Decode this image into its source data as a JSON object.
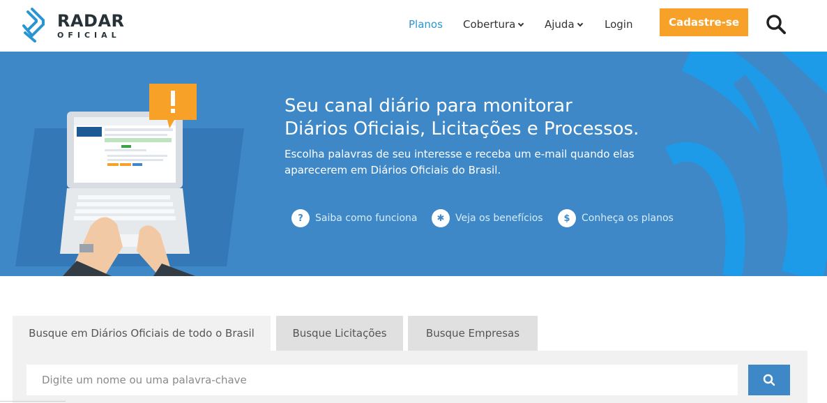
{
  "logo": {
    "word1": "RADAR",
    "word2": "OFICIAL"
  },
  "nav": {
    "items": [
      {
        "label": "Planos"
      },
      {
        "label": "Cobertura"
      },
      {
        "label": "Ajuda"
      },
      {
        "label": "Login"
      }
    ],
    "cta": "Cadastre-se",
    "search_icon": "search-icon"
  },
  "hero": {
    "title_line1": "Seu canal diário para monitorar",
    "title_line2": "Diários Oficiais, Licitações e Processos.",
    "subtitle": "Escolha palavras de seu interesse e receba um e-mail quando elas aparecerem em Diários Oficiais do Brasil.",
    "links": [
      {
        "icon": "?",
        "label": "Saiba como funciona"
      },
      {
        "icon": "✱",
        "label": "Veja os benefícios"
      },
      {
        "icon": "$",
        "label": "Conheça os planos"
      }
    ],
    "alert_icon": "!"
  },
  "search": {
    "tabs": [
      {
        "label": "Busque em Diários Oficiais de todo o Brasil"
      },
      {
        "label": "Busque Licitações"
      },
      {
        "label": "Busque Empresas"
      }
    ],
    "placeholder": "Digite um nome ou uma palavra-chave"
  },
  "colors": {
    "brand_blue": "#3e88c7",
    "accent_orange": "#f7a128",
    "nav_active": "#2a95d3"
  }
}
